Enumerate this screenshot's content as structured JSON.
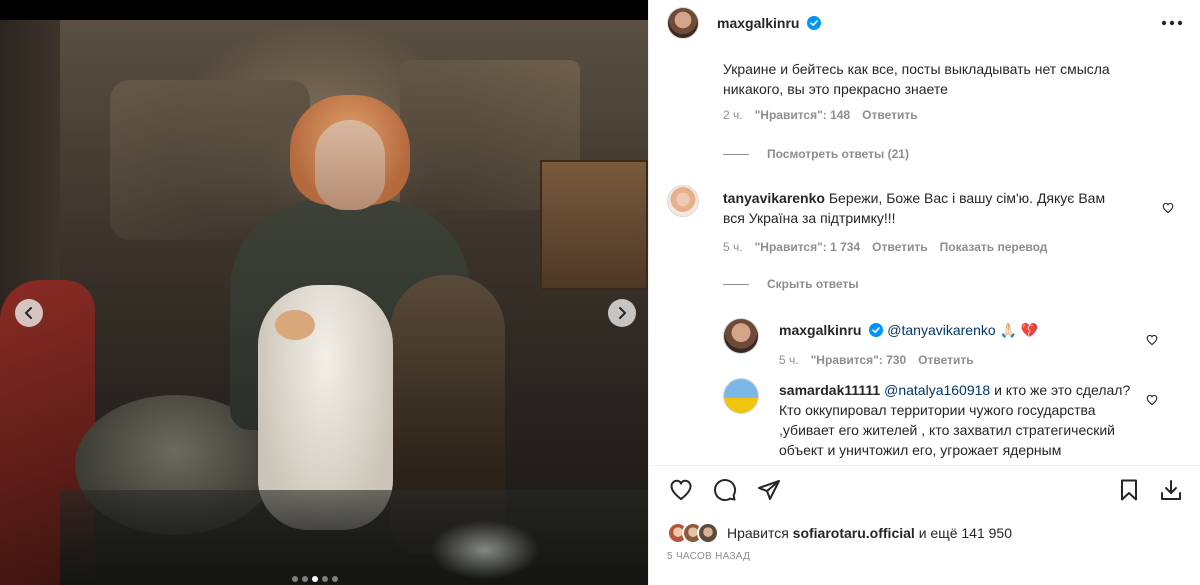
{
  "post": {
    "username": "maxgalkinru",
    "verified": true
  },
  "photo": {
    "carousel_dots": 5,
    "active_dot": 2
  },
  "comments": {
    "c1": {
      "text_line1": "Украине и бейтесь как все, посты выкладывать нет смысла",
      "text_line2": "никакого, вы это прекрасно знаете",
      "time": "2 ч.",
      "likes": "\"Нравится\": 148",
      "reply": "Ответить"
    },
    "view_replies": "Посмотреть ответы (21)",
    "c2": {
      "username": "tanyavikarenko",
      "text_line1": " Бережи, Боже Вас і вашу сім'ю. Дякує Вам",
      "text_line2": "вся Україна за підтримку!!!",
      "time": "5 ч.",
      "likes": "\"Нравится\": 1 734",
      "reply": "Ответить",
      "translate": "Показать перевод"
    },
    "hide_replies": "Скрыть ответы",
    "c3": {
      "username": "maxgalkinru",
      "mention": "@tanyavikarenko",
      "emoji": "🙏🏻 💔",
      "time": "5 ч.",
      "likes": "\"Нравится\": 730",
      "reply": "Ответить"
    },
    "c4": {
      "username": "samardak11111",
      "mention": "@natalya160918",
      "text_line1": " и кто же это сделал?",
      "text_line2": "Кто оккупировал территории чужого государства",
      "text_line3": ",убивает его жителей , кто захватил стратегический",
      "text_line4": "объект и уничтожил его, угрожает ядерным"
    }
  },
  "likes": {
    "prefix": "Нравится",
    "user": "sofiarotaru.official",
    "suffix": "и ещё 141 950"
  },
  "time_ago": "5 ЧАСОВ НАЗАД",
  "colors": {
    "text": "#262626",
    "secondary": "#8e8e8e",
    "verified": "#0095f6",
    "mention": "#00376b"
  }
}
